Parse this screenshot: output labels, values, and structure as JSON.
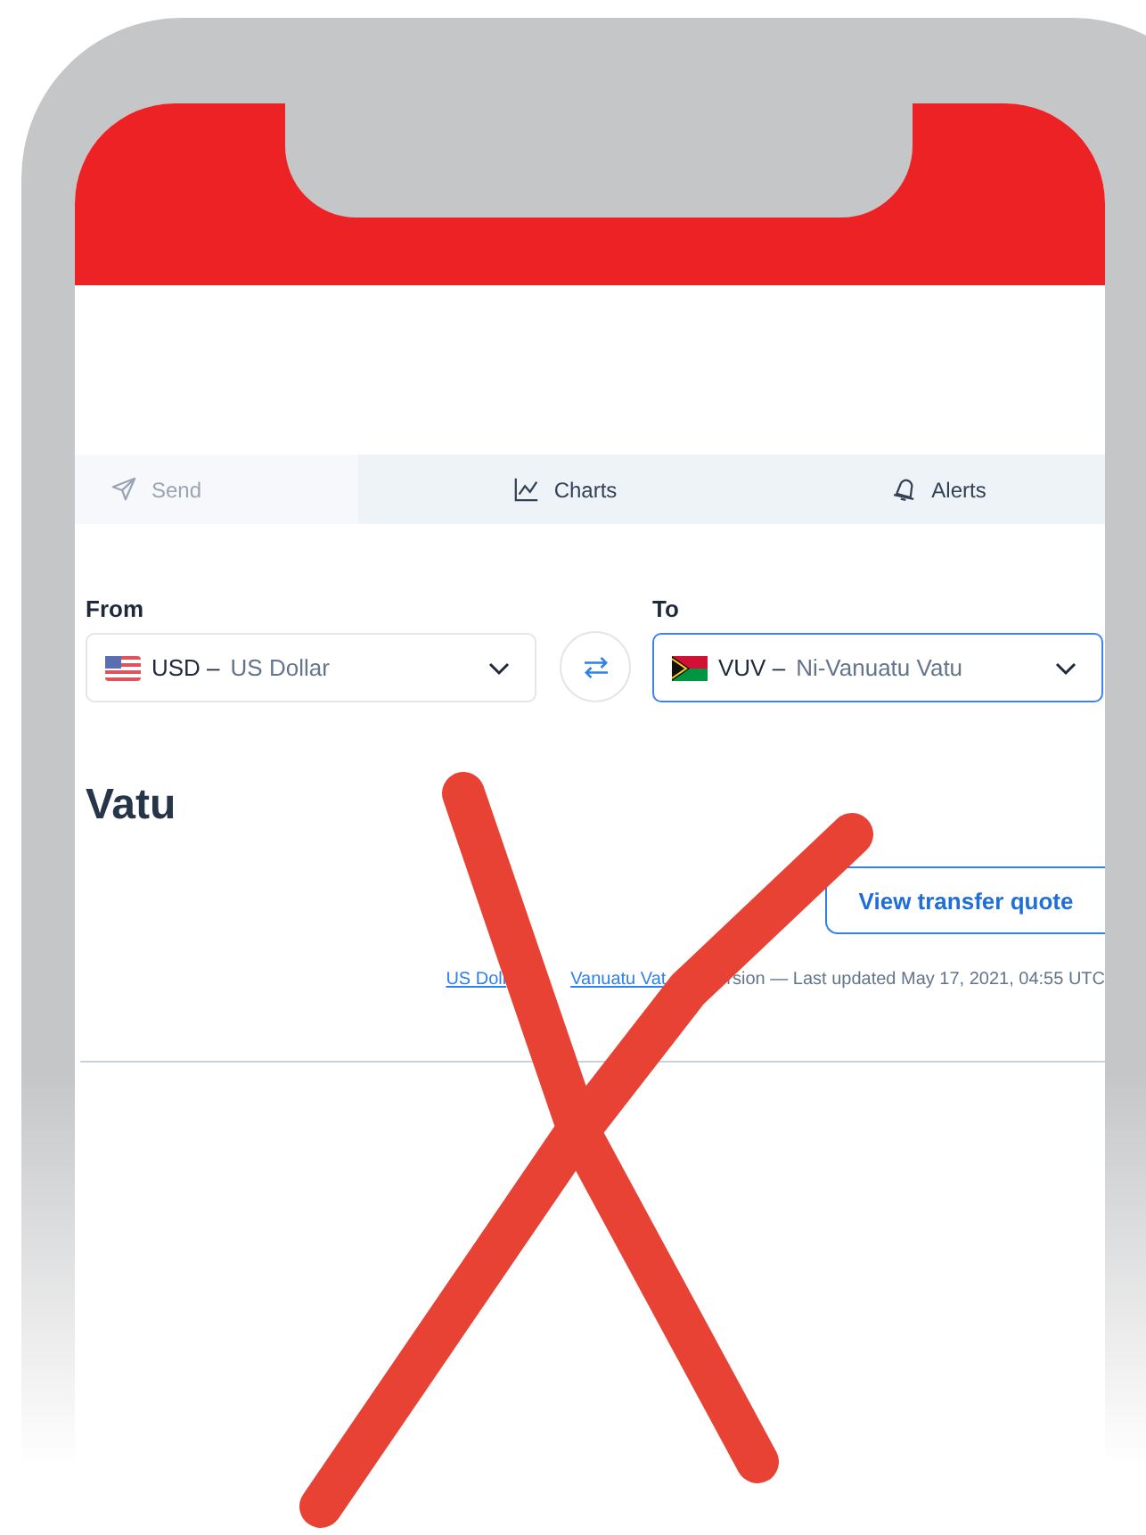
{
  "tabs": [
    {
      "kind": "send",
      "label": "Send",
      "disabled": true
    },
    {
      "kind": "charts",
      "label": "Charts",
      "disabled": false
    },
    {
      "kind": "alerts",
      "label": "Alerts",
      "disabled": false
    }
  ],
  "converter": {
    "from": {
      "label": "From",
      "kind": "us",
      "code": "USD –",
      "name": "US Dollar",
      "focused": false
    },
    "to": {
      "label": "To",
      "kind": "vu",
      "code": "VUV –",
      "name": "Ni-Vanuatu Vatu",
      "focused": true
    }
  },
  "heading": "Vatu",
  "quote_button": "View transfer quote",
  "footnote": [
    {
      "kind": "link",
      "text": "US Doll"
    },
    {
      "kind": "link",
      "text": "Vanuatu Vat"
    },
    {
      "kind": "text",
      "text": "rsion — Last updated May 17, 2021, 04:55 UTC"
    }
  ]
}
